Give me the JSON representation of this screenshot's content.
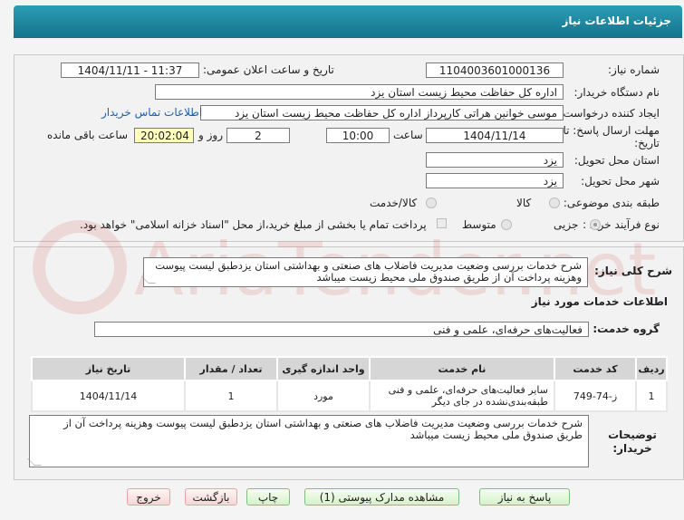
{
  "header": {
    "title": "جزئیات اطلاعات نیاز"
  },
  "form": {
    "need_number_label": "شماره نیاز:",
    "need_number": "1104003601000136",
    "announce_label": "تاریخ و ساعت اعلان عمومی:",
    "announce_value": "1404/11/11 - 11:37",
    "buyer_org_label": "نام دستگاه خریدار:",
    "buyer_org": "اداره کل حفاظت محیط زیست استان یزد",
    "creator_label": "ایجاد کننده درخواست:",
    "creator": "موسی خوانین هراتی کارپرداز اداره کل حفاظت محیط زیست استان یزد",
    "contact_link": "اطلاعات تماس خریدار",
    "deadline_label": "مهلت ارسال پاسخ: تا تاریخ:",
    "deadline_date": "1404/11/14",
    "time_label": "ساعت",
    "deadline_time": "10:00",
    "days_value": "2",
    "days_label": "روز و",
    "remaining_time": "20:02:04",
    "remaining_label": "ساعت باقی مانده",
    "province_label": "استان محل تحویل:",
    "province": "یزد",
    "city_label": "شهر محل تحویل:",
    "city": "یزد",
    "category_label": "طبقه بندی موضوعی:",
    "category_options": [
      "کالا",
      "کالا/خدمت"
    ],
    "process_label": "نوع فرآیند خرید :",
    "process_options": [
      "جزیی",
      "متوسط"
    ],
    "payment_note": "پرداخت تمام یا بخشی از مبلغ خرید،از محل \"اسناد خزانه اسلامی\" خواهد بود."
  },
  "summary": {
    "label": "شرح کلی نیاز:",
    "text": "شرح خدمات بررسی وضعیت مدیریت فاضلاب های صنعتی و بهداشتی استان یزدطبق لیست پیوست وهزینه پرداخت آن از طریق صندوق ملی محیط زیست میباشد"
  },
  "services": {
    "section_title": "اطلاعات خدمات مورد نیاز",
    "group_label": "گروه خدمت:",
    "group_value": "فعالیت‌های حرفه‌ای، علمی و فنی",
    "columns": [
      "ردیف",
      "کد خدمت",
      "نام خدمت",
      "واحد اندازه گیری",
      "تعداد / مقدار",
      "تاریخ نیاز"
    ],
    "rows": [
      {
        "row": "1",
        "code": "ز-74-749",
        "name": "سایر فعالیت‌های حرفه‌ای، علمی و فنی طبقه‌بندی‌نشده در جای دیگر",
        "unit": "مورد",
        "qty": "1",
        "date": "1404/11/14"
      }
    ]
  },
  "buyer_notes": {
    "label": "توضیحات خریدار:",
    "text": "شرح خدمات بررسی وضعیت مدیریت فاضلاب های صنعتی و بهداشتی استان یزدطبق لیست پیوست وهزینه پرداخت آن از طریق صندوق ملی محیط زیست میباشد"
  },
  "buttons": {
    "reply": "پاسخ به نیاز",
    "attachments": "مشاهده مدارک پیوستی (1)",
    "print": "چاپ",
    "back": "بازگشت",
    "exit": "خروج"
  },
  "watermark_text": "AriaTender.net"
}
